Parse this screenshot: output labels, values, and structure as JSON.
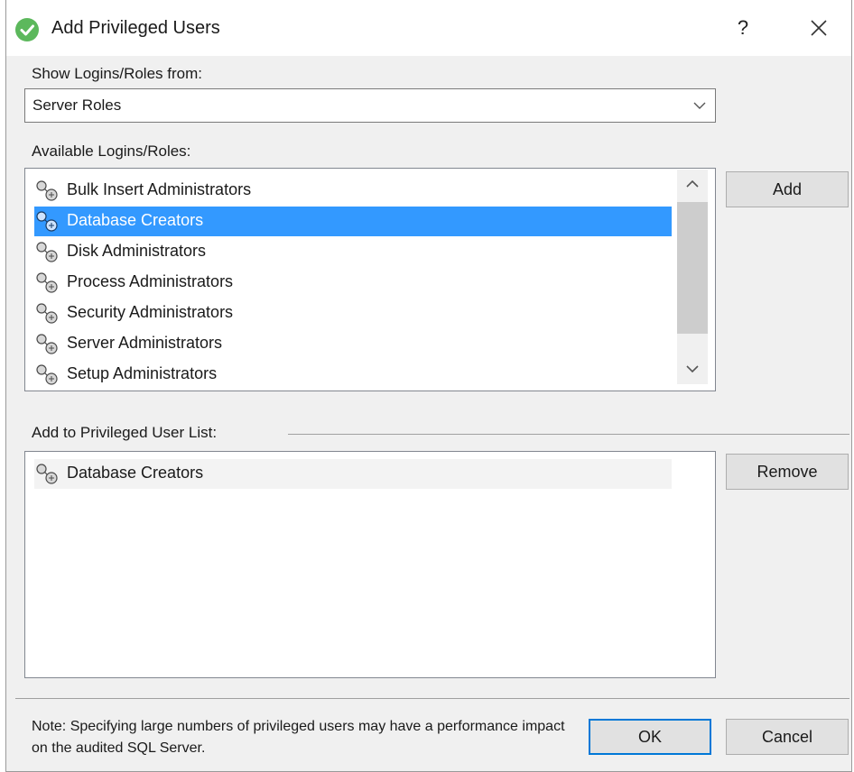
{
  "window": {
    "title": "Add Privileged Users",
    "help_label": "?",
    "app_icon": "green-check-circle-icon",
    "accent": "#5cb85c"
  },
  "source": {
    "label": "Show Logins/Roles from:",
    "value": "Server Roles"
  },
  "available": {
    "label": "Available Logins/Roles:",
    "items": [
      {
        "label": "Bulk Insert Administrators",
        "icon": "server-role-key-icon"
      },
      {
        "label": "Database Creators",
        "icon": "server-role-key-icon"
      },
      {
        "label": "Disk Administrators",
        "icon": "server-role-key-icon"
      },
      {
        "label": "Process Administrators",
        "icon": "server-role-key-icon"
      },
      {
        "label": "Security Administrators",
        "icon": "server-role-key-icon"
      },
      {
        "label": "Server Administrators",
        "icon": "server-role-key-icon"
      },
      {
        "label": "Setup Administrators",
        "icon": "server-role-key-icon"
      }
    ],
    "selected_index": 1,
    "selection_color": "#3399ff"
  },
  "privileged": {
    "label": "Add to Privileged User List:",
    "items": [
      {
        "label": "Database Creators",
        "icon": "server-role-key-icon"
      }
    ]
  },
  "buttons": {
    "add": "Add",
    "remove": "Remove",
    "ok": "OK",
    "cancel": "Cancel"
  },
  "note": "Note: Specifying large numbers of privileged users may have a performance impact on the audited SQL Server."
}
